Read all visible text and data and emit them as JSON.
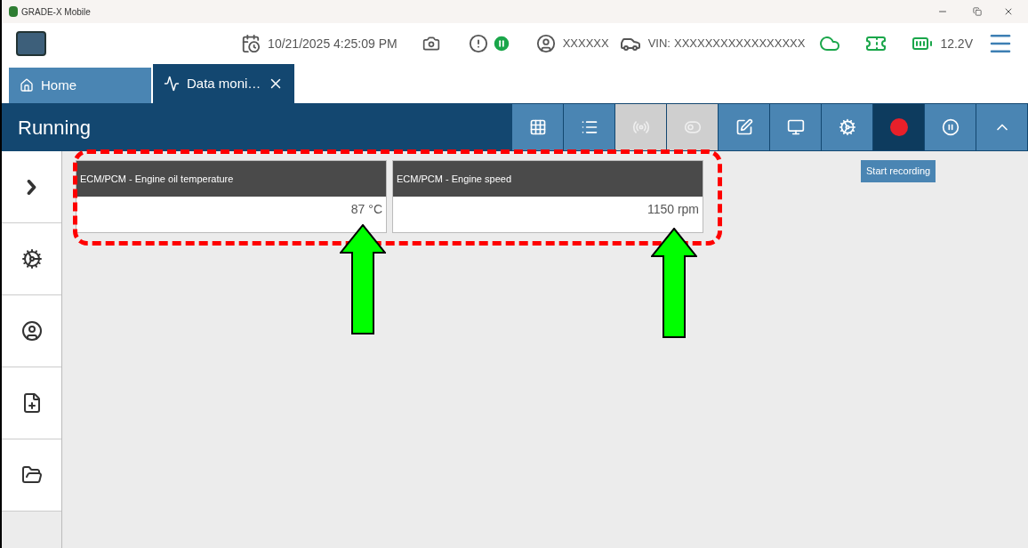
{
  "window": {
    "title": "GRADE-X Mobile"
  },
  "header": {
    "datetime": "10/21/2025 4:25:09 PM",
    "user": "XXXXXX",
    "vin_label": "VIN:",
    "vin": "XXXXXXXXXXXXXXXXX",
    "voltage": "12.2V"
  },
  "tabs": [
    {
      "label": "Home",
      "selected": false,
      "closable": false
    },
    {
      "label": "Data moni…",
      "selected": true,
      "closable": true
    }
  ],
  "toolbar": {
    "title": "Running",
    "buttons": [
      {
        "disabled": false,
        "selected": false
      },
      {
        "disabled": false,
        "selected": false
      },
      {
        "disabled": true,
        "selected": false
      },
      {
        "disabled": true,
        "selected": false
      },
      {
        "disabled": false,
        "selected": false
      },
      {
        "disabled": false,
        "selected": false
      },
      {
        "disabled": false,
        "selected": false
      },
      {
        "disabled": false,
        "selected": true
      },
      {
        "disabled": false,
        "selected": false
      },
      {
        "disabled": false,
        "selected": false
      }
    ],
    "tooltip": "Start recording"
  },
  "cards": [
    {
      "title": "ECM/PCM  - Engine oil temperature",
      "value": "87 °C"
    },
    {
      "title": "ECM/PCM  - Engine speed",
      "value": "1150 rpm"
    }
  ]
}
